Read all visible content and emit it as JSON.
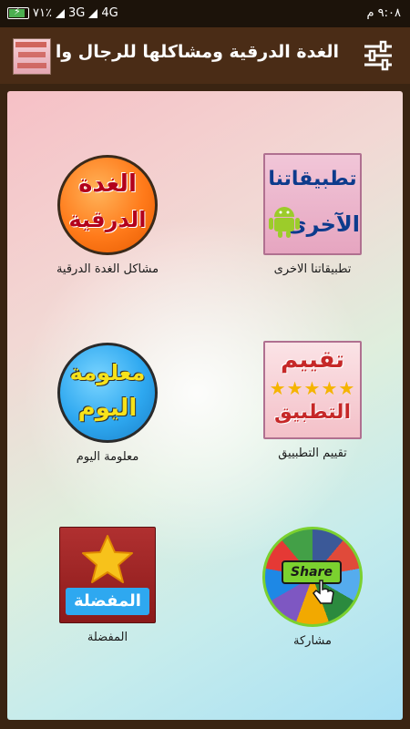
{
  "status_bar": {
    "battery": "٧١٪",
    "network_3g": "3G",
    "network_4g": "4G",
    "time": "٩:٠٨ م"
  },
  "app_bar": {
    "title": "الغدة الدرقية ومشاكلها للرجال والنساء",
    "icon": "app-logo-icon",
    "menu_icon": "sliders-icon"
  },
  "tiles": [
    {
      "label": "تطبيقاتنا الاخرى",
      "art_text_1": "تطبيقاتنا",
      "art_text_2": "الآخرى",
      "icon": "android-icon"
    },
    {
      "label": "مشاكل الغدة الدرقية",
      "art_text_1": "الغدة",
      "art_text_2": "الدرقية"
    },
    {
      "label": "تقييم التطبييق",
      "art_text_1": "تقييم",
      "art_text_2": "التطبيق",
      "stars": "★★★★★"
    },
    {
      "label": "معلومة اليوم",
      "art_text_1": "معلومة",
      "art_text_2": "اليوم"
    },
    {
      "label": "مشاركة",
      "art_text_1": "Share",
      "icon": "share-hand-icon"
    },
    {
      "label": "المفضلة",
      "art_text_1": "المفضلة",
      "icon": "star-icon"
    }
  ],
  "colors": {
    "status_bar": "#1c130a",
    "app_bar": "#4a2c16",
    "background": "#3a2412",
    "accent_orange": "#ff7a1a",
    "accent_blue": "#2ea8f0",
    "accent_green": "#7bd12f",
    "accent_red": "#c62828"
  }
}
